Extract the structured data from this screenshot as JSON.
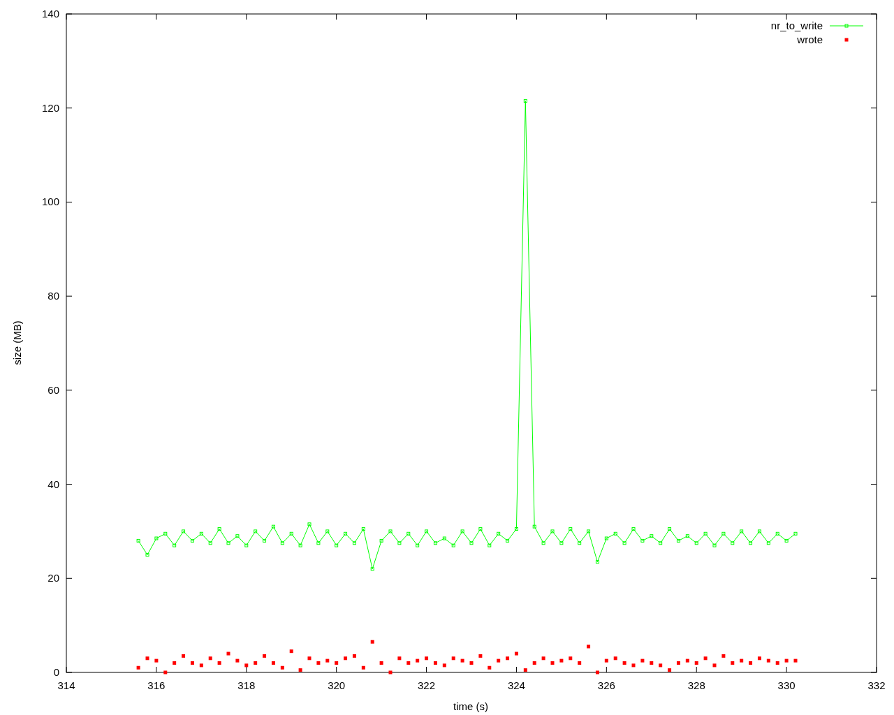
{
  "chart": {
    "chart_data": {
      "type": "line",
      "xlabel": "time (s)",
      "ylabel": "size (MB)",
      "xlim": [
        314,
        332
      ],
      "ylim": [
        0,
        140
      ],
      "xticks": [
        314,
        316,
        318,
        320,
        322,
        324,
        326,
        328,
        330,
        332
      ],
      "yticks": [
        0,
        20,
        40,
        60,
        80,
        100,
        120,
        140
      ],
      "legend": "top right",
      "x": [
        315.6,
        315.8,
        316.0,
        316.2,
        316.4,
        316.6,
        316.8,
        317.0,
        317.2,
        317.4,
        317.6,
        317.8,
        318.0,
        318.2,
        318.4,
        318.6,
        318.8,
        319.0,
        319.2,
        319.4,
        319.6,
        319.8,
        320.0,
        320.2,
        320.4,
        320.6,
        320.8,
        321.0,
        321.2,
        321.4,
        321.6,
        321.8,
        322.0,
        322.2,
        322.4,
        322.6,
        322.8,
        323.0,
        323.2,
        323.4,
        323.6,
        323.8,
        324.0,
        324.2,
        324.4,
        324.6,
        324.8,
        325.0,
        325.2,
        325.4,
        325.6,
        325.8,
        326.0,
        326.2,
        326.4,
        326.6,
        326.8,
        327.0,
        327.2,
        327.4,
        327.6,
        327.8,
        328.0,
        328.2,
        328.4,
        328.6,
        328.8,
        329.0,
        329.2,
        329.4,
        329.6,
        329.8,
        330.0,
        330.2
      ],
      "series": [
        {
          "name": "nr_to_write",
          "color": "#00ff00",
          "type": "line",
          "marker": "square",
          "values": [
            28,
            25,
            28.5,
            29.5,
            27,
            30,
            28,
            29.5,
            27.5,
            30.5,
            27.5,
            29,
            27,
            30,
            28,
            31,
            27.5,
            29.5,
            27,
            31.5,
            27.5,
            30,
            27,
            29.5,
            27.5,
            30.5,
            22,
            28,
            30,
            27.5,
            29.5,
            27,
            30,
            27.5,
            28.5,
            27,
            30,
            27.5,
            30.5,
            27,
            29.5,
            28,
            30.5,
            121.5,
            31,
            27.5,
            30,
            27.5,
            30.5,
            27.5,
            30,
            23.5,
            28.5,
            29.5,
            27.5,
            30.5,
            28,
            29,
            27.5,
            30.5,
            28,
            29,
            27.5,
            29.5,
            27,
            29.5,
            27.5,
            30,
            27.5,
            30,
            27.5,
            29.5,
            28,
            29.5
          ]
        },
        {
          "name": "wrote",
          "color": "#ff0000",
          "type": "scatter",
          "values": [
            1,
            3,
            2.5,
            0,
            2,
            3.5,
            2,
            1.5,
            3,
            2,
            4,
            2.5,
            1.5,
            2,
            3.5,
            2,
            1,
            4.5,
            0.5,
            3,
            2,
            2.5,
            2,
            3,
            3.5,
            1,
            6.5,
            2,
            0,
            3,
            2,
            2.5,
            3,
            2,
            1.5,
            3,
            2.5,
            2,
            3.5,
            1,
            2.5,
            3,
            4,
            0.5,
            2,
            3,
            2,
            2.5,
            3,
            2,
            5.5,
            0,
            2.5,
            3,
            2,
            1.5,
            2.5,
            2,
            1.5,
            0.5,
            2,
            2.5,
            2,
            3,
            1.5,
            3.5,
            2,
            2.5,
            2,
            3,
            2.5,
            2,
            2.5,
            2.5
          ]
        }
      ]
    }
  }
}
